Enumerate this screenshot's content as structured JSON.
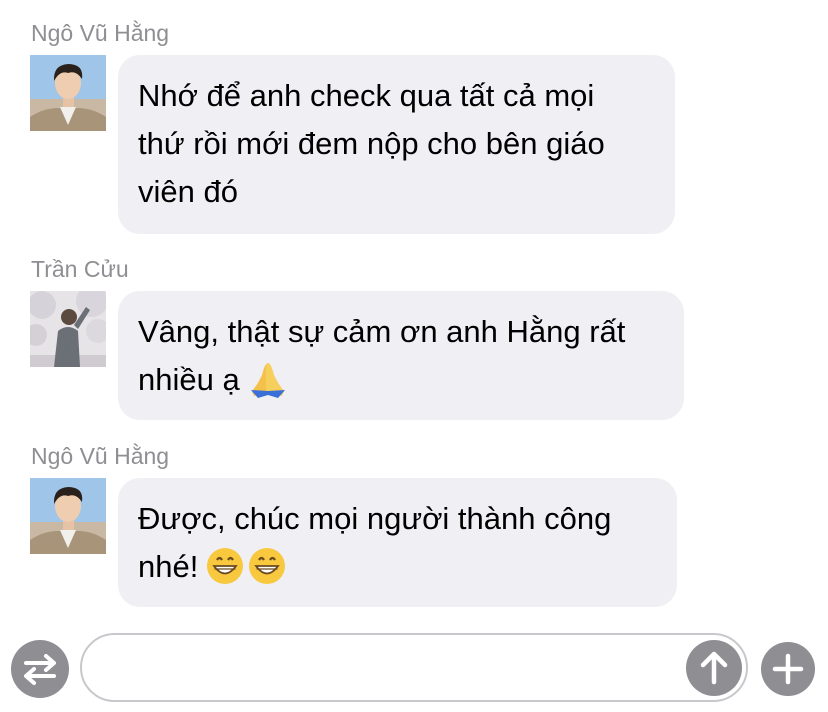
{
  "messages": [
    {
      "sender": "Ngô Vũ Hằng",
      "avatar": "portrait-photo",
      "lines": [
        "Nhớ để anh check qua tất cả mọi",
        "thứ rồi mới đem nộp cho bên giáo",
        "viên đó"
      ]
    },
    {
      "sender": "Trần Cửu",
      "avatar": "cherry-blossom-photo",
      "lines": [
        "Vâng, thật sự cảm ơn anh Hằng rất",
        "nhiều ạ"
      ],
      "emoji": [
        "folded-hands-emoji"
      ]
    },
    {
      "sender": "Ngô Vũ Hằng",
      "avatar": "portrait-photo",
      "lines": [
        "Được, chúc mọi người thành công",
        "nhé!"
      ],
      "emoji": [
        "grinning-face-emoji",
        "grinning-face-emoji"
      ]
    }
  ],
  "composer": {
    "input_value": "",
    "toggle_icon": "swap-arrows-icon",
    "send_icon": "arrow-up-icon",
    "add_icon": "plus-icon"
  },
  "colors": {
    "bubble": "#efeff4",
    "sender_name": "#8e8e93",
    "icon_button": "#8e8e93",
    "input_border": "#c7c7cc"
  }
}
